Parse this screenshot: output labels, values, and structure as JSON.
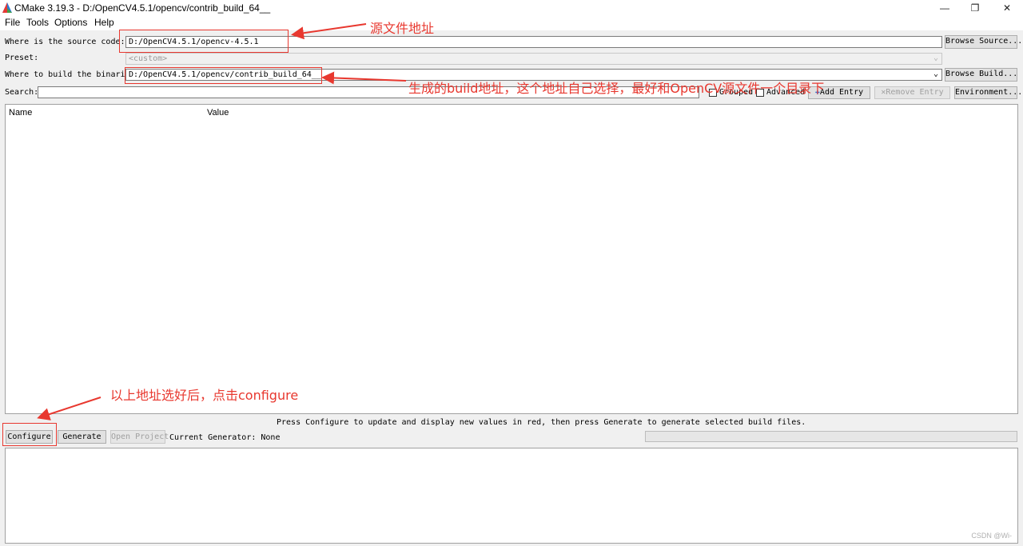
{
  "window": {
    "title": "CMake 3.19.3 - D:/OpenCV4.5.1/opencv/contrib_build_64__",
    "controls": [
      "—",
      "❐",
      "✕"
    ]
  },
  "menu": [
    "File",
    "Tools",
    "Options",
    "Help"
  ],
  "source": {
    "label": "Where is the source code:",
    "value": "D:/OpenCV4.5.1/opencv-4.5.1",
    "button": "Browse Source..."
  },
  "preset": {
    "label": "Preset:",
    "value": "<custom>"
  },
  "binaries": {
    "label": "Where to build the binaries:",
    "value": "D:/OpenCV4.5.1/opencv/contrib_build_64__",
    "button": "Browse Build..."
  },
  "search": {
    "label": "Search:",
    "value": ""
  },
  "options": {
    "grouped": "Grouped",
    "advanced": "Advanced",
    "add_entry": "Add Entry",
    "remove_entry": "Remove Entry",
    "environment": "Environment..."
  },
  "table": {
    "col_name": "Name",
    "col_value": "Value"
  },
  "status_message": "Press Configure to update and display new values in red, then press Generate to generate selected build files.",
  "actions": {
    "configure": "Configure",
    "generate": "Generate",
    "open_project": "Open Project",
    "current_generator": "Current Generator: None"
  },
  "progress": 0,
  "annotations": {
    "source": "源文件地址",
    "build": "生成的build地址，这个地址自己选择，最好和OpenCV源文件一个目录下",
    "configure": "以上地址选好后，点击configure",
    "color": "#e8382f"
  },
  "watermark": "CSDN @Wi-"
}
